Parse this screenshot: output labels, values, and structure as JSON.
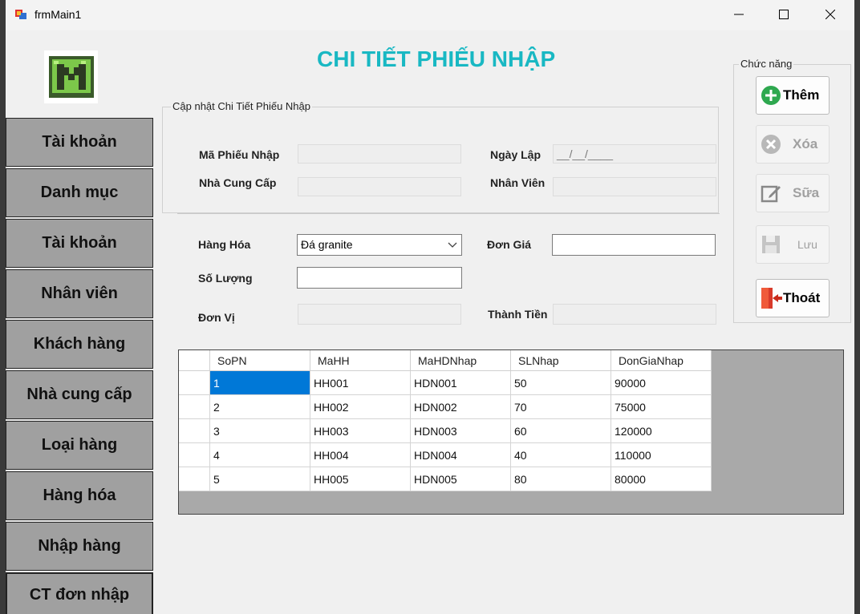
{
  "window": {
    "title": "frmMain1"
  },
  "sidebar": {
    "items": [
      {
        "label": "Tài khoản"
      },
      {
        "label": "Danh mục"
      },
      {
        "label": "Tài khoản"
      },
      {
        "label": "Nhân viên"
      },
      {
        "label": "Khách hàng"
      },
      {
        "label": "Nhà cung cấp"
      },
      {
        "label": "Loại hàng"
      },
      {
        "label": "Hàng hóa"
      },
      {
        "label": "Nhập hàng"
      },
      {
        "label": "CT đơn nhập"
      }
    ]
  },
  "page": {
    "title": "CHI TIẾT PHIẾU NHẬP"
  },
  "update_group": {
    "legend": "Cập nhật Chi Tiết Phiếu Nhập",
    "ma_phieu_nhap_label": "Mã Phiếu Nhập",
    "ma_phieu_nhap_value": "",
    "ngay_lap_label": "Ngày Lập",
    "ngay_lap_value": "__/__/____",
    "nha_cung_cap_label": "Nhà Cung Cấp",
    "nha_cung_cap_value": "",
    "nhan_vien_label": "Nhân Viên",
    "nhan_vien_value": ""
  },
  "detail": {
    "hang_hoa_label": "Hàng Hóa",
    "hang_hoa_selected": "Đá granite",
    "don_gia_label": "Đơn Giá",
    "don_gia_value": "",
    "so_luong_label": "Số Lượng",
    "so_luong_value": "",
    "don_vi_label": "Đơn Vị",
    "don_vi_value": "",
    "thanh_tien_label": "Thành Tiền",
    "thanh_tien_value": ""
  },
  "functions": {
    "legend": "Chức năng",
    "them": "Thêm",
    "xoa": "Xóa",
    "sua": "Sữa",
    "luu": "Lưu",
    "thoat": "Thoát"
  },
  "grid": {
    "columns": [
      "SoPN",
      "MaHH",
      "MaHDNhap",
      "SLNhap",
      "DonGiaNhap"
    ],
    "rows": [
      [
        "1",
        "HH001",
        "HDN001",
        "50",
        "90000"
      ],
      [
        "2",
        "HH002",
        "HDN002",
        "70",
        "75000"
      ],
      [
        "3",
        "HH003",
        "HDN003",
        "60",
        "120000"
      ],
      [
        "4",
        "HH004",
        "HDN004",
        "40",
        "110000"
      ],
      [
        "5",
        "HH005",
        "HDN005",
        "80",
        "80000"
      ]
    ]
  },
  "colors": {
    "title": "#19b8c3",
    "selection": "#0078d7",
    "sidebar": "#a0a0a0"
  }
}
